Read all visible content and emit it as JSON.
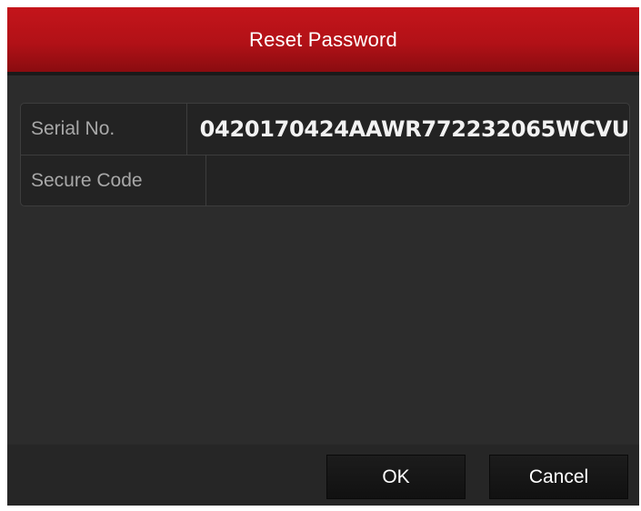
{
  "dialog": {
    "title": "Reset Password"
  },
  "fields": {
    "serial_label": "Serial No.",
    "serial_value": "0420170424AAWR772232065WCVU",
    "secure_code_label": "Secure Code",
    "secure_code_value": ""
  },
  "buttons": {
    "ok_label": "OK",
    "cancel_label": "Cancel"
  },
  "colors": {
    "title_bar": "#b21117",
    "background": "#2b2b2b",
    "text": "#ffffff"
  }
}
